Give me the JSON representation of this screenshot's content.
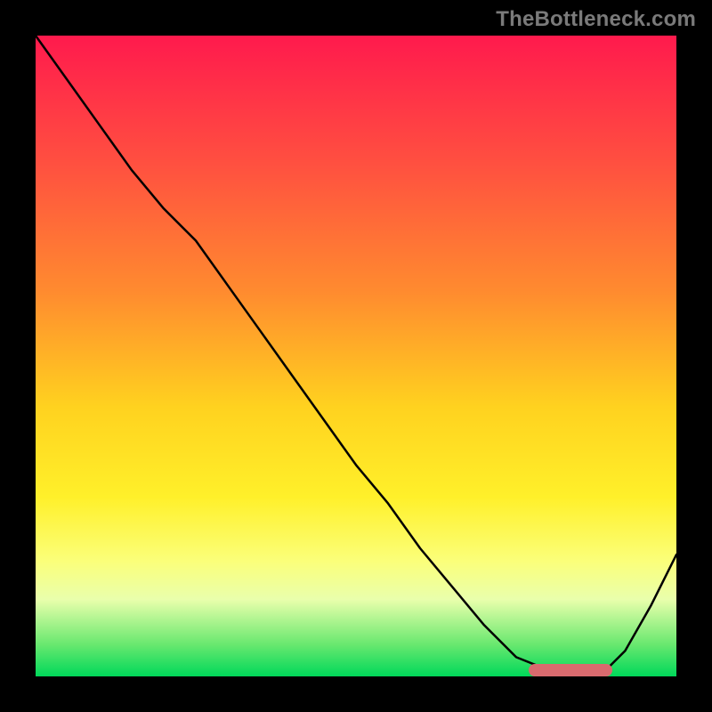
{
  "watermark": "TheBottleneck.com",
  "colors": {
    "gradient_top": "#ff1a4d",
    "gradient_mid1": "#ff8b2f",
    "gradient_mid2": "#fff02a",
    "gradient_bottom": "#00d85a",
    "curve": "#000000",
    "marker": "#d86a6e",
    "background": "#000000"
  },
  "chart_data": {
    "type": "line",
    "title": "",
    "xlabel": "",
    "ylabel": "",
    "xlim": [
      0,
      100
    ],
    "ylim": [
      0,
      100
    ],
    "grid": false,
    "series": [
      {
        "name": "bottleneck-curve",
        "x": [
          0,
          5,
          10,
          15,
          20,
          25,
          30,
          35,
          40,
          45,
          50,
          55,
          60,
          65,
          70,
          75,
          80,
          83,
          88,
          92,
          96,
          100
        ],
        "y": [
          100,
          93,
          86,
          79,
          73,
          68,
          61,
          54,
          47,
          40,
          33,
          27,
          20,
          14,
          8,
          3,
          1,
          0,
          0,
          4,
          11,
          19
        ]
      }
    ],
    "annotations": [
      {
        "name": "optimal-range-marker",
        "x_start": 77,
        "x_end": 90,
        "y": 1
      }
    ]
  }
}
